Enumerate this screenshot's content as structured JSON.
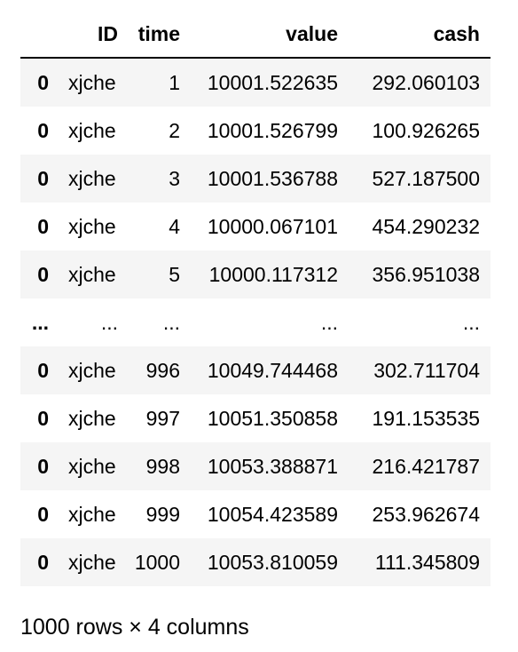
{
  "table": {
    "columns": {
      "index": "",
      "id": "ID",
      "time": "time",
      "value": "value",
      "cash": "cash"
    },
    "rows": [
      {
        "index": "0",
        "id": "xjche",
        "time": "1",
        "value": "10001.522635",
        "cash": "292.060103"
      },
      {
        "index": "0",
        "id": "xjche",
        "time": "2",
        "value": "10001.526799",
        "cash": "100.926265"
      },
      {
        "index": "0",
        "id": "xjche",
        "time": "3",
        "value": "10001.536788",
        "cash": "527.187500"
      },
      {
        "index": "0",
        "id": "xjche",
        "time": "4",
        "value": "10000.067101",
        "cash": "454.290232"
      },
      {
        "index": "0",
        "id": "xjche",
        "time": "5",
        "value": "10000.117312",
        "cash": "356.951038"
      },
      {
        "index": "...",
        "id": "...",
        "time": "...",
        "value": "...",
        "cash": "..."
      },
      {
        "index": "0",
        "id": "xjche",
        "time": "996",
        "value": "10049.744468",
        "cash": "302.711704"
      },
      {
        "index": "0",
        "id": "xjche",
        "time": "997",
        "value": "10051.350858",
        "cash": "191.153535"
      },
      {
        "index": "0",
        "id": "xjche",
        "time": "998",
        "value": "10053.388871",
        "cash": "216.421787"
      },
      {
        "index": "0",
        "id": "xjche",
        "time": "999",
        "value": "10054.423589",
        "cash": "253.962674"
      },
      {
        "index": "0",
        "id": "xjche",
        "time": "1000",
        "value": "10053.810059",
        "cash": "111.345809"
      }
    ]
  },
  "shape_caption": "1000 rows × 4 columns"
}
